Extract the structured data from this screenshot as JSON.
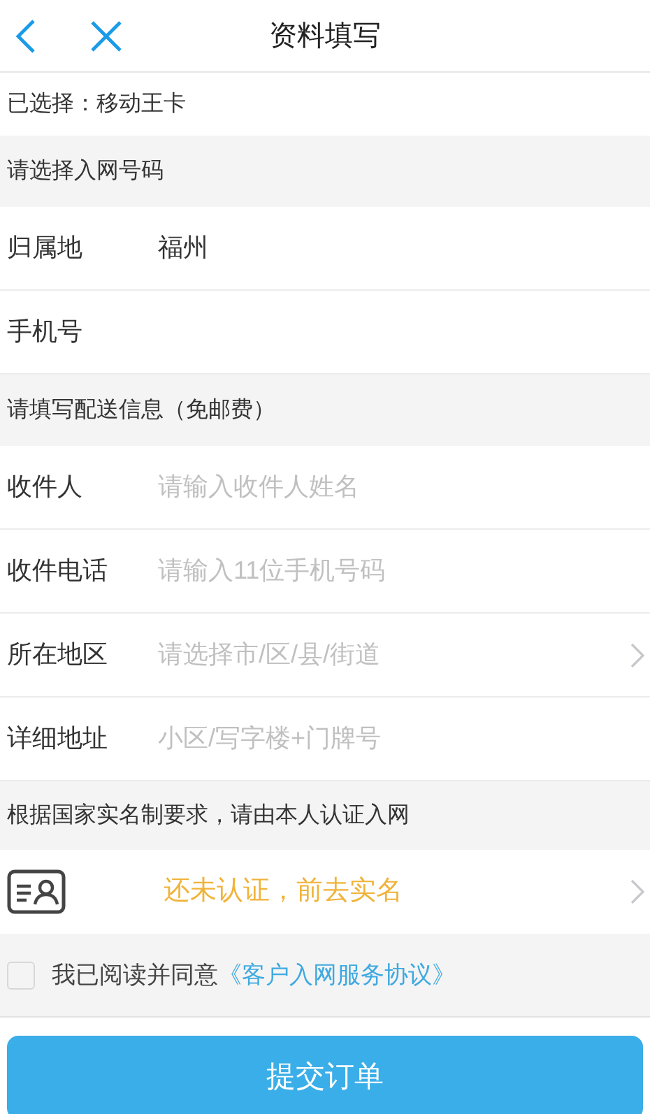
{
  "header": {
    "title": "资料填写"
  },
  "selected_plan": "已选择：移动王卡",
  "sections": [
    {
      "title": "请选择入网号码",
      "rows": [
        {
          "kind": "value",
          "label": "归属地",
          "value": "福州"
        },
        {
          "kind": "value",
          "label": "手机号"
        }
      ]
    },
    {
      "title": "请填写配送信息（免邮费）",
      "rows": [
        {
          "kind": "input",
          "label": "收件人",
          "placeholder": "请输入收件人姓名"
        },
        {
          "kind": "input",
          "label": "收件电话",
          "placeholder": "请输入11位手机号码"
        },
        {
          "kind": "select",
          "label": "所在地区",
          "placeholder": "请选择市/区/县/街道"
        },
        {
          "kind": "input",
          "label": "详细地址",
          "placeholder": "小区/写字楼+门牌号"
        }
      ]
    }
  ],
  "verification": {
    "notice": "根据国家实名制要求，请由本人认证入网",
    "status": "还未认证，前去实名"
  },
  "agreement": {
    "checked": false,
    "text": "我已阅读并同意",
    "link": "《客户入网服务协议》"
  },
  "submit": "提交订单"
}
